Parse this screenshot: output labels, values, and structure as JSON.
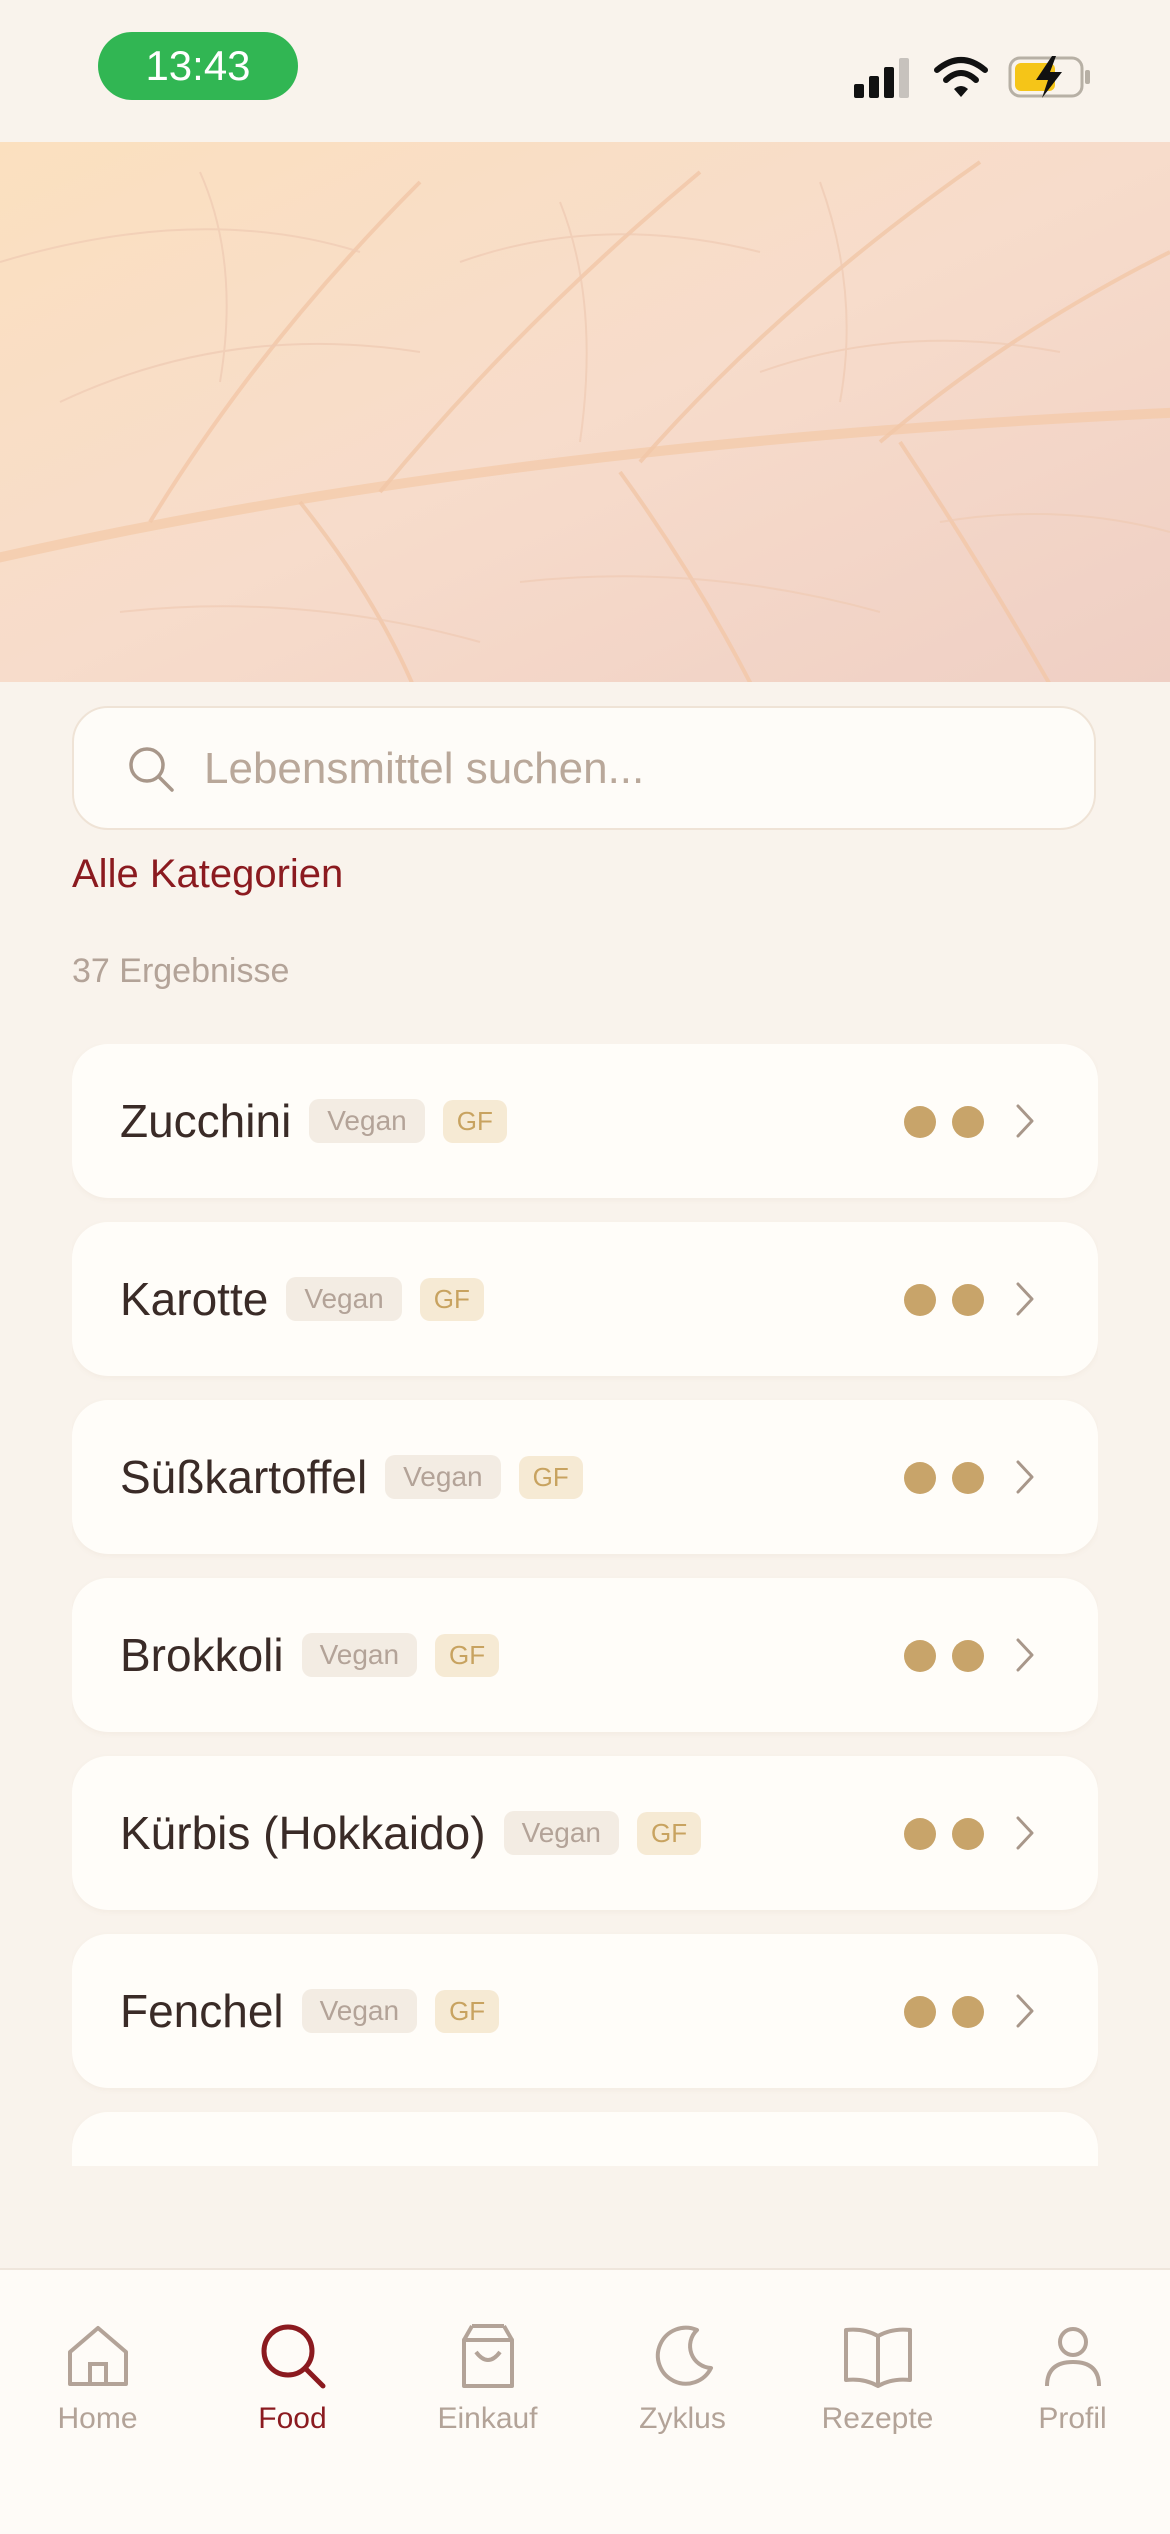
{
  "status_bar": {
    "time": "13:43",
    "time_pill_color": "#31b653"
  },
  "search": {
    "placeholder": "Lebensmittel suchen..."
  },
  "filter": {
    "category_label": "Alle Kategorien"
  },
  "results": {
    "count_text": "37 Ergebnisse"
  },
  "foods": [
    {
      "name": "Zucchini",
      "tags": [
        "Vegan",
        "GF"
      ],
      "rating_dots": 2
    },
    {
      "name": "Karotte",
      "tags": [
        "Vegan",
        "GF"
      ],
      "rating_dots": 2
    },
    {
      "name": "Süßkartoffel",
      "tags": [
        "Vegan",
        "GF"
      ],
      "rating_dots": 2
    },
    {
      "name": "Brokkoli",
      "tags": [
        "Vegan",
        "GF"
      ],
      "rating_dots": 2
    },
    {
      "name": "Kürbis (Hokkaido)",
      "tags": [
        "Vegan",
        "GF"
      ],
      "rating_dots": 2
    },
    {
      "name": "Fenchel",
      "tags": [
        "Vegan",
        "GF"
      ],
      "rating_dots": 2
    }
  ],
  "tab_bar": {
    "active": "Food",
    "accent_color": "#8b1a1f",
    "tabs": [
      {
        "label": "Home",
        "icon": "home-icon"
      },
      {
        "label": "Food",
        "icon": "search-icon"
      },
      {
        "label": "Einkauf",
        "icon": "shopping-bag-icon"
      },
      {
        "label": "Zyklus",
        "icon": "moon-icon"
      },
      {
        "label": "Rezepte",
        "icon": "book-icon"
      },
      {
        "label": "Profil",
        "icon": "profile-icon"
      }
    ]
  }
}
